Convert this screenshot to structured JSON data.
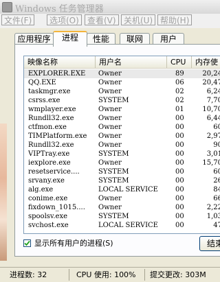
{
  "window": {
    "title": "Windows 任务管理器"
  },
  "menu": [
    "文件(F)",
    "选项(O)",
    "查看(V)",
    "关机(U)",
    "帮助(H)"
  ],
  "tabs": [
    "应用程序",
    "进程",
    "性能",
    "联网",
    "用户"
  ],
  "active_tab": "进程",
  "columns": [
    "映像名称",
    "用户名",
    "CPU",
    "内存使用"
  ],
  "processes": [
    {
      "name": "EXPLORER.EXE",
      "user": "Owner",
      "cpu": "89",
      "mem": "20,24"
    },
    {
      "name": "QQ.EXE",
      "user": "Owner",
      "cpu": "06",
      "mem": "20,47"
    },
    {
      "name": "taskmgr.exe",
      "user": "Owner",
      "cpu": "02",
      "mem": "6,24"
    },
    {
      "name": "csrss.exe",
      "user": "SYSTEM",
      "cpu": "02",
      "mem": "7,70"
    },
    {
      "name": "wmplayer.exe",
      "user": "Owner",
      "cpu": "01",
      "mem": "10,70"
    },
    {
      "name": "Rundll32.exe",
      "user": "Owner",
      "cpu": "00",
      "mem": "6,44"
    },
    {
      "name": "ctfmon.exe",
      "user": "Owner",
      "cpu": "00",
      "mem": "60"
    },
    {
      "name": "TIMPlatform.exe",
      "user": "Owner",
      "cpu": "00",
      "mem": "2,97"
    },
    {
      "name": "Rundll32.exe",
      "user": "Owner",
      "cpu": "00",
      "mem": "90"
    },
    {
      "name": "VIPTray.exe",
      "user": "SYSTEM",
      "cpu": "00",
      "mem": "3,01"
    },
    {
      "name": "iexplore.exe",
      "user": "Owner",
      "cpu": "00",
      "mem": "15,70"
    },
    {
      "name": "resetservice....",
      "user": "SYSTEM",
      "cpu": "00",
      "mem": "60"
    },
    {
      "name": "srvany.exe",
      "user": "SYSTEM",
      "cpu": "00",
      "mem": "26"
    },
    {
      "name": "alg.exe",
      "user": "LOCAL SERVICE",
      "cpu": "00",
      "mem": "84"
    },
    {
      "name": "conime.exe",
      "user": "Owner",
      "cpu": "00",
      "mem": "66"
    },
    {
      "name": "fixdown_1015....",
      "user": "Owner",
      "cpu": "00",
      "mem": "2,22"
    },
    {
      "name": "spoolsv.exe",
      "user": "SYSTEM",
      "cpu": "00",
      "mem": "1,03"
    },
    {
      "name": "svchost.exe",
      "user": "LOCAL SERVICE",
      "cpu": "00",
      "mem": "47"
    }
  ],
  "show_all_users": {
    "label": "显示所有用户的进程(S)",
    "checked": true
  },
  "end_process_label": "结束",
  "status": {
    "processes": "进程数: 32",
    "cpu": "CPU 使用: 100%",
    "commit": "提交更改: 303M"
  }
}
